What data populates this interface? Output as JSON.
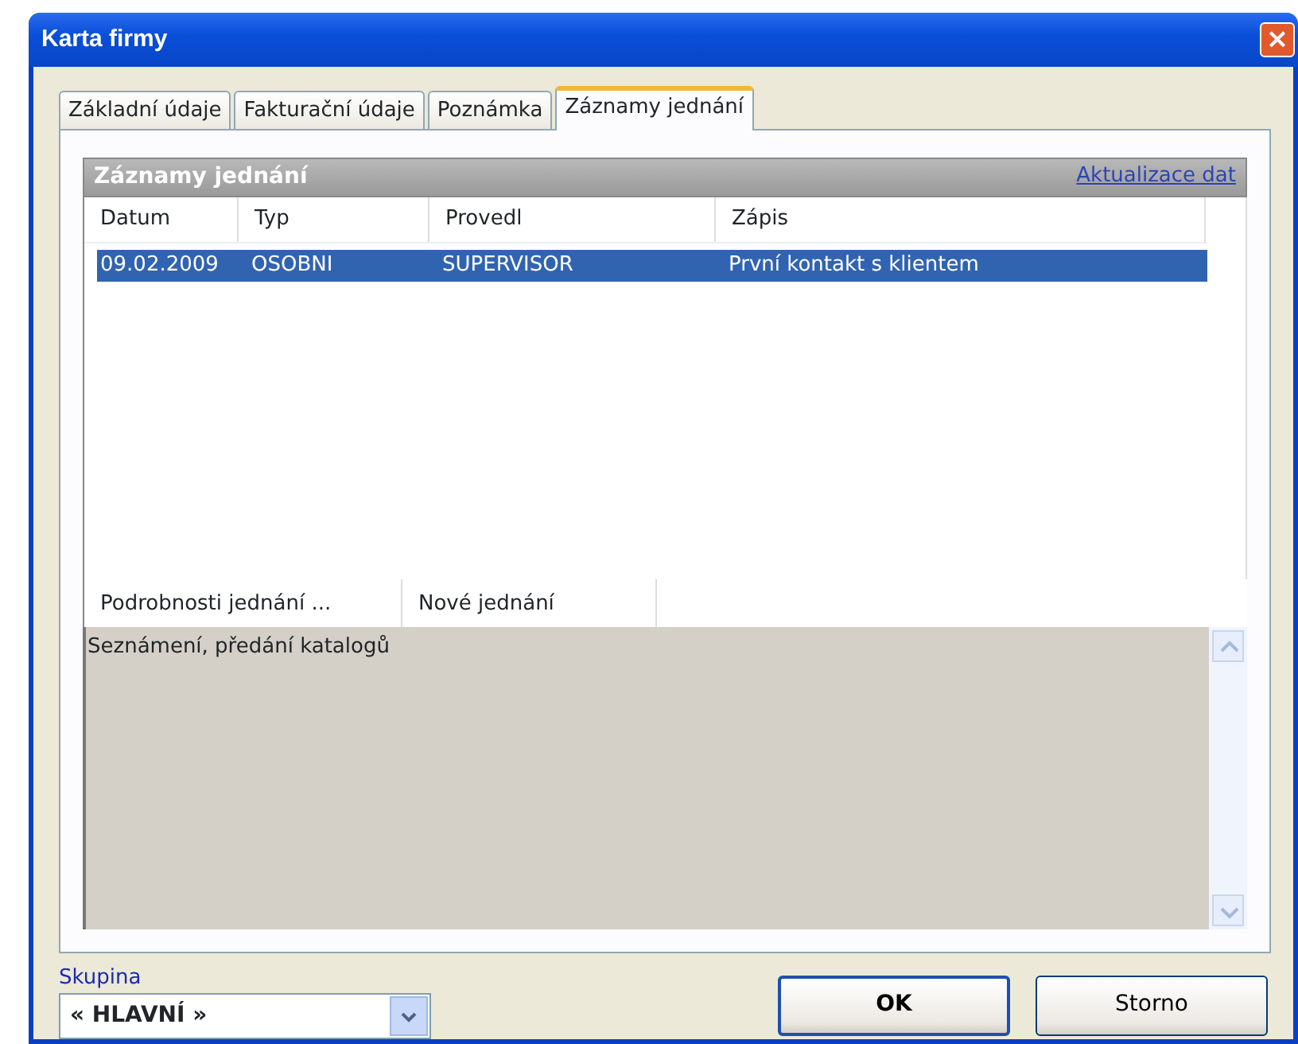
{
  "window": {
    "title": "Karta firmy",
    "close": "×"
  },
  "tabs": [
    {
      "label": "Základní údaje",
      "selected": false
    },
    {
      "label": "Fakturační údaje",
      "selected": false
    },
    {
      "label": "Poznámka",
      "selected": false
    },
    {
      "label": "Záznamy jednání",
      "selected": true
    }
  ],
  "panel": {
    "title": "Záznamy jednání",
    "link": "Aktualizace dat"
  },
  "table": {
    "columns": [
      "Datum",
      "Typ",
      "Provedl",
      "Zápis"
    ],
    "rows": [
      {
        "cells": [
          "09.02.2009",
          "OSOBNI",
          "SUPERVISOR",
          "První kontakt s klientem"
        ],
        "selected": true
      }
    ]
  },
  "detail_tabs": [
    "Podrobnosti jednání ...",
    "Nové jednání"
  ],
  "detail_text": "Seznámení, předání katalogů",
  "group": {
    "label": "Skupina",
    "value": "« HLAVNÍ »"
  },
  "buttons": [
    {
      "label": "OK",
      "default": true
    },
    {
      "label": "Storno",
      "default": false
    }
  ]
}
